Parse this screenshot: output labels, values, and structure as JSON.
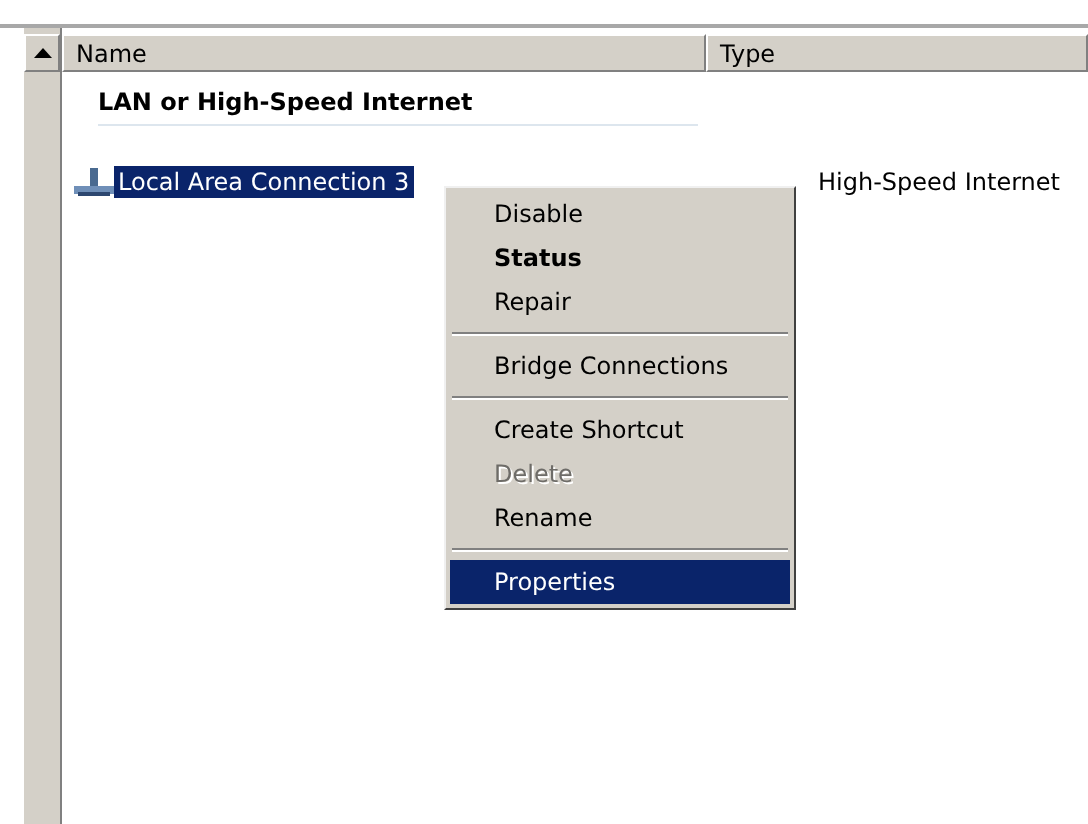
{
  "columns": [
    {
      "label": "Name"
    },
    {
      "label": "Type"
    }
  ],
  "group": {
    "title": "LAN or High-Speed Internet"
  },
  "rows": [
    {
      "name": "Local Area Connection 3",
      "type": "High-Speed Internet",
      "selected": true
    }
  ],
  "context_menu": {
    "items": [
      {
        "kind": "item",
        "label": "Disable",
        "bold": false,
        "disabled": false,
        "selected": false
      },
      {
        "kind": "item",
        "label": "Status",
        "bold": true,
        "disabled": false,
        "selected": false
      },
      {
        "kind": "item",
        "label": "Repair",
        "bold": false,
        "disabled": false,
        "selected": false
      },
      {
        "kind": "separator"
      },
      {
        "kind": "item",
        "label": "Bridge Connections",
        "bold": false,
        "disabled": false,
        "selected": false
      },
      {
        "kind": "separator"
      },
      {
        "kind": "item",
        "label": "Create Shortcut",
        "bold": false,
        "disabled": false,
        "selected": false
      },
      {
        "kind": "item",
        "label": "Delete",
        "bold": false,
        "disabled": true,
        "selected": false
      },
      {
        "kind": "item",
        "label": "Rename",
        "bold": false,
        "disabled": false,
        "selected": false
      },
      {
        "kind": "separator"
      },
      {
        "kind": "item",
        "label": "Properties",
        "bold": false,
        "disabled": false,
        "selected": true
      }
    ]
  }
}
